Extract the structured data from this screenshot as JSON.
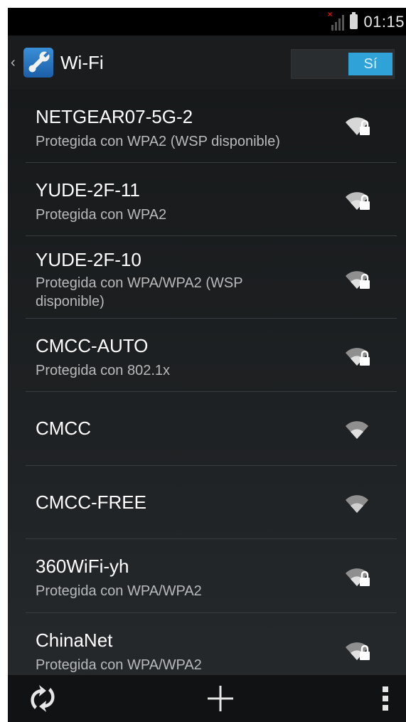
{
  "status_bar": {
    "time": "01:15",
    "signal_icon": "no-signal-icon",
    "battery_icon": "battery-icon"
  },
  "action_bar": {
    "title": "Wi-Fi",
    "back_icon": "chevron-left-icon",
    "app_icon": "settings-wrench-icon",
    "toggle_label": "Sí",
    "toggle_on": true
  },
  "networks": [
    {
      "ssid": "NETGEAR07-5G-2",
      "status": "Protegida con WPA2 (WSP disponible)",
      "secured": true
    },
    {
      "ssid": "YUDE-2F-11",
      "status": "Protegida con WPA2",
      "secured": true
    },
    {
      "ssid": "YUDE-2F-10",
      "status": "Protegida con WPA/WPA2 (WSP disponible)",
      "secured": true
    },
    {
      "ssid": "CMCC-AUTO",
      "status": "Protegida con 802.1x",
      "secured": true
    },
    {
      "ssid": "CMCC",
      "status": "",
      "secured": false
    },
    {
      "ssid": "CMCC-FREE",
      "status": "",
      "secured": false
    },
    {
      "ssid": "360WiFi-yh",
      "status": "Protegida con WPA/WPA2",
      "secured": true
    },
    {
      "ssid": "ChinaNet",
      "status": "Protegida con WPA/WPA2",
      "secured": true
    }
  ],
  "bottom_bar": {
    "wps_icon": "wps-icon",
    "add_icon": "add-network-icon",
    "menu_icon": "overflow-menu-icon"
  },
  "colors": {
    "accent": "#2fa3d8",
    "background": "#1f2224"
  }
}
